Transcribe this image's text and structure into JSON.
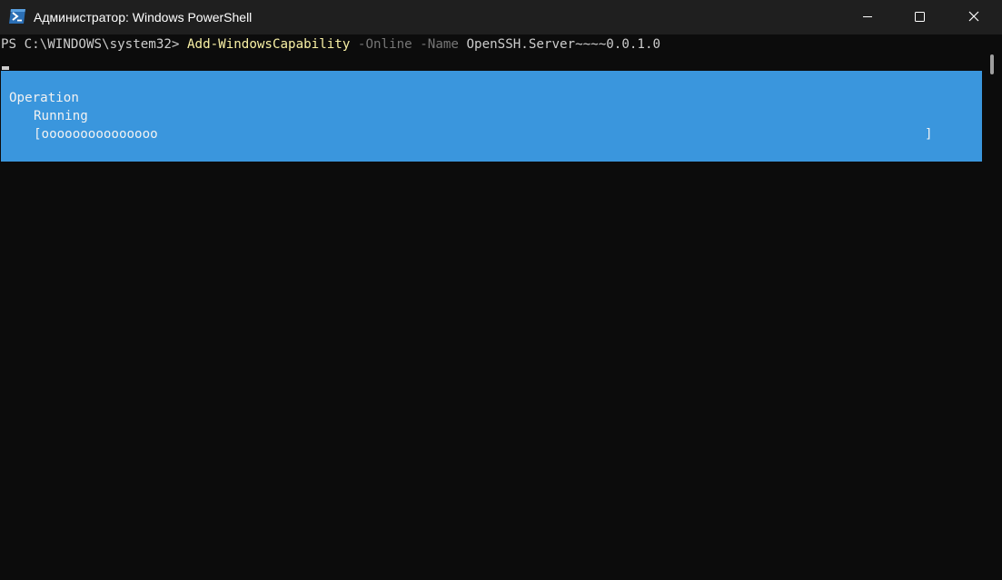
{
  "window": {
    "title": "Администратор: Windows PowerShell",
    "icon": "powershell-icon",
    "controls": {
      "minimize": "minimize-icon",
      "maximize": "maximize-icon",
      "close": "close-icon"
    }
  },
  "terminal": {
    "prompt": "PS C:\\WINDOWS\\system32> ",
    "cmdlet": "Add-WindowsCapability",
    "param_online": " -Online",
    "param_name": " -Name",
    "argument": " OpenSSH.Server~~~~0.0.1.0"
  },
  "progress": {
    "activity": "Operation",
    "status": "Running",
    "bar_start": "[ooooooooooooooo",
    "bar_end": "]"
  },
  "colors": {
    "background": "#0c0c0c",
    "titlebar": "#1f1f1f",
    "progress_background": "#3a96dd",
    "cmdlet": "#f9f1a5",
    "parameter": "#767676",
    "text": "#cccccc"
  }
}
